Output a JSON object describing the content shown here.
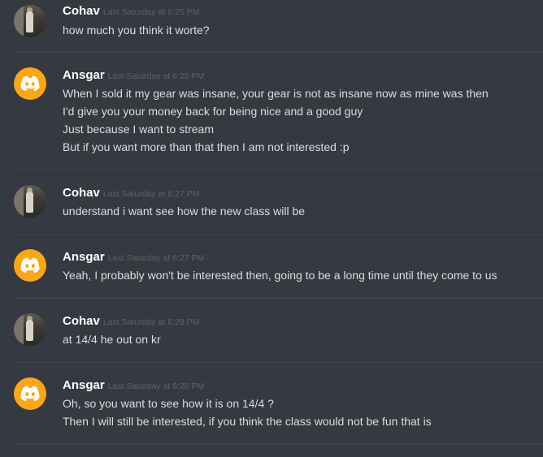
{
  "messages": [
    {
      "author": "Cohav",
      "timestamp": "Last Saturday at 6:25 PM",
      "avatar": "user-photo",
      "lines": [
        "how much you think it worte?"
      ]
    },
    {
      "author": "Ansgar",
      "timestamp": "Last Saturday at 6:25 PM",
      "avatar": "discord-logo",
      "lines": [
        "When I sold it my gear was insane, your gear is not as insane now as mine was then",
        "I'd give you your money back for being nice and a good guy",
        "Just because I want to stream",
        "But if you want more than that then I am not interested :p"
      ]
    },
    {
      "author": "Cohav",
      "timestamp": "Last Saturday at 6:27 PM",
      "avatar": "user-photo",
      "lines": [
        "understand i want see how the new class will be"
      ]
    },
    {
      "author": "Ansgar",
      "timestamp": "Last Saturday at 6:27 PM",
      "avatar": "discord-logo",
      "lines": [
        "Yeah, I probably won't be interested then, going to be a long time until they come to us"
      ]
    },
    {
      "author": "Cohav",
      "timestamp": "Last Saturday at 6:28 PM",
      "avatar": "user-photo",
      "lines": [
        "at 14/4 he out on kr"
      ]
    },
    {
      "author": "Ansgar",
      "timestamp": "Last Saturday at 6:28 PM",
      "avatar": "discord-logo",
      "lines": [
        "Oh, so you want to see how it is on 14/4 ?",
        "Then I will still be interested, if you think the class would not be fun that is"
      ]
    }
  ],
  "colors": {
    "background": "#36393f",
    "divider": "#40444b",
    "author": "#ffffff",
    "timestamp": "#5f6268",
    "text": "#dcddde",
    "discord_avatar": "#faa61a"
  }
}
